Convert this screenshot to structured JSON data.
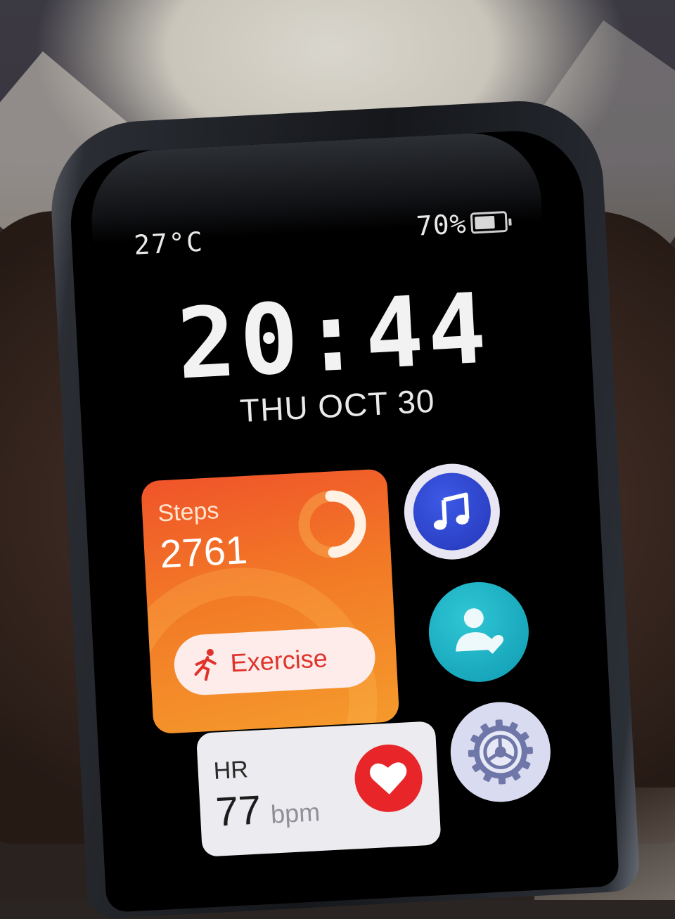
{
  "status": {
    "temperature": "27°C",
    "battery_percent": "70%",
    "battery_level": 0.7
  },
  "clock": {
    "time": "20:44",
    "date": "THU  OCT 30"
  },
  "steps_widget": {
    "label": "Steps",
    "value": "2761",
    "exercise_label": "Exercise"
  },
  "hr_widget": {
    "label": "HR",
    "value": "77",
    "unit": "bpm"
  },
  "shortcuts": {
    "music_icon": "music-note-icon",
    "health_icon": "person-heart-icon",
    "settings_icon": "gear-icon"
  },
  "colors": {
    "steps_card": "#f27a26",
    "exercise_text": "#e0322a",
    "music": "#2c44d0",
    "health": "#1fb2c4",
    "heart": "#e8262a"
  }
}
